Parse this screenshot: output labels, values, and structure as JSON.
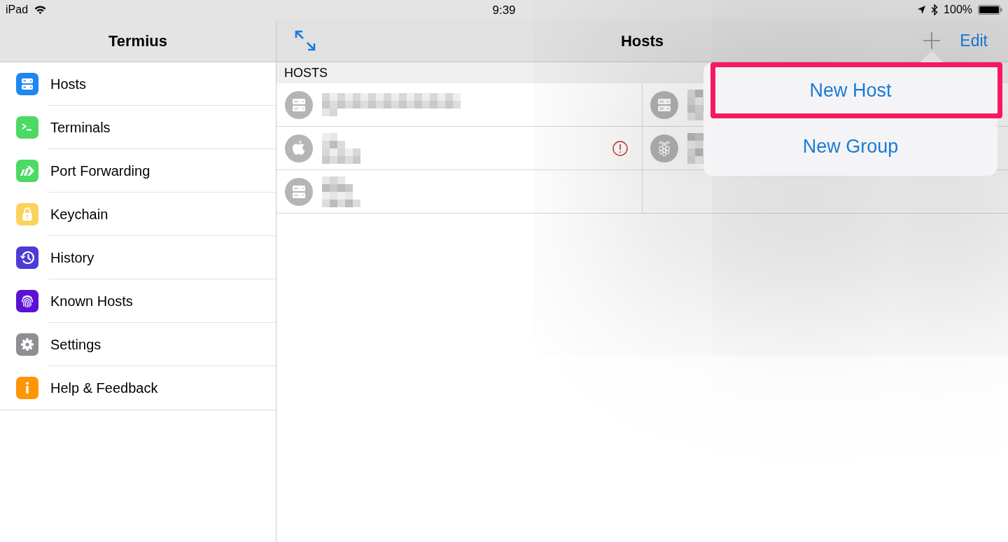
{
  "status_bar": {
    "carrier": "iPad",
    "time": "9:39",
    "battery": "100%"
  },
  "sidebar": {
    "title": "Termius",
    "items": [
      {
        "label": "Hosts",
        "color": "#1e87f0"
      },
      {
        "label": "Terminals",
        "color": "#4cd964"
      },
      {
        "label": "Port Forwarding",
        "color": "#4cd964"
      },
      {
        "label": "Keychain",
        "color": "#fcd25f"
      },
      {
        "label": "History",
        "color": "#4c3bd6"
      },
      {
        "label": "Known Hosts",
        "color": "#5a12d2"
      },
      {
        "label": "Settings",
        "color": "#8e8e93"
      },
      {
        "label": "Help & Feedback",
        "color": "#ff9500"
      }
    ]
  },
  "main": {
    "title": "Hosts",
    "edit_button": "Edit",
    "section": "HOSTS",
    "hosts": [
      {
        "warning": false
      },
      {
        "warning": false
      },
      {
        "warning": true
      },
      {
        "warning": false
      },
      {
        "warning": false
      }
    ]
  },
  "menu": {
    "items": [
      {
        "label": "New Host",
        "highlighted": true
      },
      {
        "label": "New Group",
        "highlighted": false
      }
    ]
  }
}
